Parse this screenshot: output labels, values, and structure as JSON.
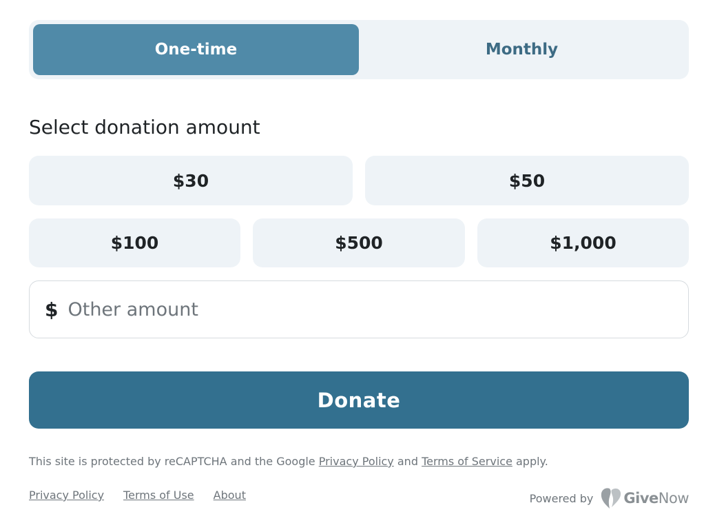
{
  "frequency": {
    "one_time_label": "One-time",
    "monthly_label": "Monthly",
    "selected": "One-time"
  },
  "amounts": {
    "title": "Select donation amount",
    "options": [
      "$30",
      "$50",
      "$100",
      "$500",
      "$1,000"
    ]
  },
  "other_amount": {
    "currency_symbol": "$",
    "placeholder": "Other amount",
    "value": ""
  },
  "donate_label": "Donate",
  "recaptcha": {
    "text_before": "This site is protected by reCAPTCHA and the Google ",
    "privacy_link": "Privacy Policy",
    "text_middle": " and ",
    "terms_link": "Terms of Service",
    "text_after": " apply."
  },
  "footer": {
    "links": [
      "Privacy Policy",
      "Terms of Use",
      "About"
    ],
    "powered_by": "Powered by",
    "brand_bold": "Give",
    "brand_light": "Now"
  },
  "colors": {
    "accent": "#33708f",
    "toggle_active": "#508aa8",
    "option_bg": "#eef3f7"
  },
  "icons": {
    "brand_logo": "givenow-heart-icon"
  }
}
